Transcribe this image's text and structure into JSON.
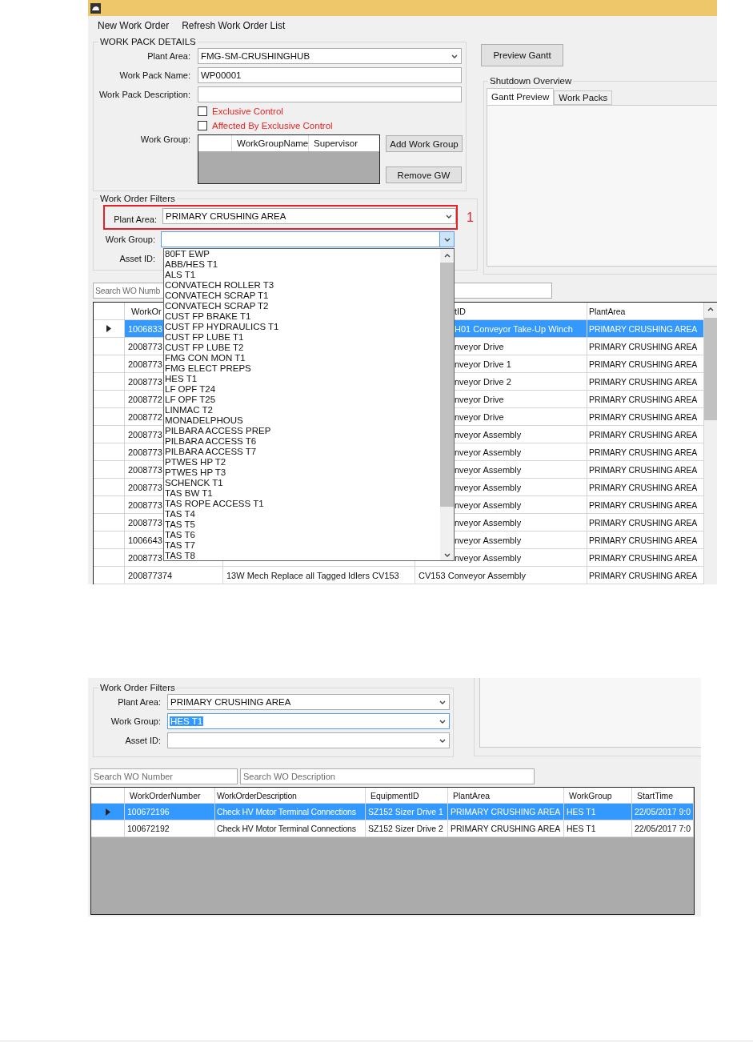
{
  "work_pack_screen": {
    "menu": [
      "New Work Order",
      "Refresh Work Order List"
    ],
    "work_pack_details": {
      "title": "WORK PACK DETAILS",
      "plant_area": {
        "label": "Plant Area:",
        "value": "FMG-SM-CRUSHINGHUB"
      },
      "work_pack_name": {
        "label": "Work Pack Name:",
        "value": "WP00001"
      },
      "work_pack_description": {
        "label": "Work Pack Description:"
      },
      "checkboxes": [
        {
          "label": "Exclusive Control",
          "checked": false
        },
        {
          "label": "Affected By Exclusive Control",
          "checked": false
        }
      ],
      "work_group": {
        "label": "Work Group:",
        "columns": [
          "WorkGroupName",
          "Supervisor"
        ]
      },
      "buttons": [
        "Add Work Group",
        "Remove GW"
      ]
    },
    "preview_button": "Preview Gantt",
    "shutdown_overview": {
      "title": "Shutdown Overview",
      "tabs": [
        {
          "label": "Gantt Preview",
          "selected": true
        },
        {
          "label": "Work Packs",
          "selected": false
        }
      ]
    },
    "filters": {
      "title": "Work Order Filters",
      "plant_area": {
        "label": "Plant Area:",
        "value": "PRIMARY CRUSHING AREA"
      },
      "work_group": {
        "label": "Work Group:",
        "open": true
      },
      "asset_id": {
        "label": "Asset ID:"
      }
    },
    "callout": "1",
    "search": {
      "placeholder": "Search WO Numb"
    },
    "grid": {
      "columns": {
        "column_1": "WorkOr",
        "column_3": "tID",
        "column_4": "PlantArea"
      },
      "rows": [
        {
          "column_1": "1006833",
          "column_3": "H01 Conveyor Take-Up Winch",
          "column_4": "PRIMARY CRUSHING AREA",
          "selected": true
        },
        {
          "column_1": "2008773",
          "column_3": "nveyor Drive",
          "column_4": "PRIMARY CRUSHING AREA",
          "selected": false
        },
        {
          "column_1": "2008773",
          "column_3": "nveyor Drive 1",
          "column_4": "PRIMARY CRUSHING AREA",
          "selected": false
        },
        {
          "column_1": "2008773",
          "column_3": "nveyor Drive 2",
          "column_4": "PRIMARY CRUSHING AREA",
          "selected": false
        },
        {
          "column_1": "2008772",
          "column_3": "nveyor Drive",
          "column_4": "PRIMARY CRUSHING AREA",
          "selected": false
        },
        {
          "column_1": "2008772",
          "column_3": "nveyor Drive",
          "column_4": "PRIMARY CRUSHING AREA",
          "selected": false
        },
        {
          "column_1": "2008773",
          "column_3": "nveyor Assembly",
          "column_4": "PRIMARY CRUSHING AREA",
          "selected": false
        },
        {
          "column_1": "2008773",
          "column_3": "nveyor Assembly",
          "column_4": "PRIMARY CRUSHING AREA",
          "selected": false
        },
        {
          "column_1": "2008773",
          "column_3": "nveyor Assembly",
          "column_4": "PRIMARY CRUSHING AREA",
          "selected": false
        },
        {
          "column_1": "2008773",
          "column_3": "nveyor Assembly",
          "column_4": "PRIMARY CRUSHING AREA",
          "selected": false
        },
        {
          "column_1": "2008773",
          "column_3": "nveyor Assembly",
          "column_4": "PRIMARY CRUSHING AREA",
          "selected": false
        },
        {
          "column_1": "2008773",
          "column_3": "nveyor Assembly",
          "column_4": "PRIMARY CRUSHING AREA",
          "selected": false
        },
        {
          "column_1": "1006643",
          "column_3": "nveyor Assembly",
          "column_4": "PRIMARY CRUSHING AREA",
          "selected": false
        },
        {
          "column_1": "2008773",
          "column_3": "nveyor Assembly",
          "column_4": "PRIMARY CRUSHING AREA",
          "selected": false
        },
        {
          "column_1": "200877374",
          "column_2": "13W Mech Replace all Tagged Idlers CV153",
          "column_3": "CV153 Conveyor Assembly",
          "column_4": "PRIMARY CRUSHING AREA",
          "selected": false
        }
      ]
    },
    "dropdown": {
      "items": [
        "80FT EWP",
        "ABB/HES T1",
        "ALS T1",
        "CONVATECH ROLLER T3",
        "CONVATECH SCRAP T1",
        "CONVATECH SCRAP T2",
        "CUST FP BRAKE T1",
        "CUST FP HYDRAULICS T1",
        "CUST FP LUBE T1",
        "CUST FP LUBE T2",
        "FMG CON MON T1",
        "FMG ELECT PREPS",
        "HES T1",
        "LF OPF T24",
        "LF OPF T25",
        "LINMAC T2",
        "MONADELPHOUS",
        "PILBARA ACCESS PREP",
        "PILBARA ACCESS T6",
        "PILBARA ACCESS T7",
        "PTWES HP T2",
        "PTWES HP T3",
        "SCHENCK T1",
        "TAS BW T1",
        "TAS ROPE ACCESS T1",
        "TAS T4",
        "TAS T5",
        "TAS T6",
        "TAS T7",
        "TAS T8"
      ]
    }
  },
  "filtered_screen": {
    "filters": {
      "title": "Work Order Filters",
      "plant_area": {
        "label": "Plant Area:",
        "value": "PRIMARY CRUSHING AREA"
      },
      "work_group": {
        "label": "Work Group:",
        "value": "HES T1",
        "value_selected": true
      },
      "asset_id": {
        "label": "Asset ID:"
      }
    },
    "search": [
      {
        "placeholder": "Search WO Number"
      },
      {
        "placeholder": "Search WO Description"
      }
    ],
    "grid": {
      "columns": [
        "WorkOrderNumber",
        "WorkOrderDescription",
        "EquipmentID",
        "PlantArea",
        "WorkGroup",
        "StartTime"
      ],
      "rows": [
        {
          "cells": [
            "100672196",
            "Check HV Motor Terminal Connections",
            "SZ152 Sizer Drive 1",
            "PRIMARY CRUSHING AREA",
            "HES T1",
            "22/05/2017 9:0"
          ],
          "selected": true
        },
        {
          "cells": [
            "100672192",
            "Check HV Motor Terminal Connections",
            "SZ152 Sizer Drive 2",
            "PRIMARY CRUSHING AREA",
            "HES T1",
            "22/05/2017 7:0"
          ],
          "selected": false
        }
      ]
    }
  }
}
